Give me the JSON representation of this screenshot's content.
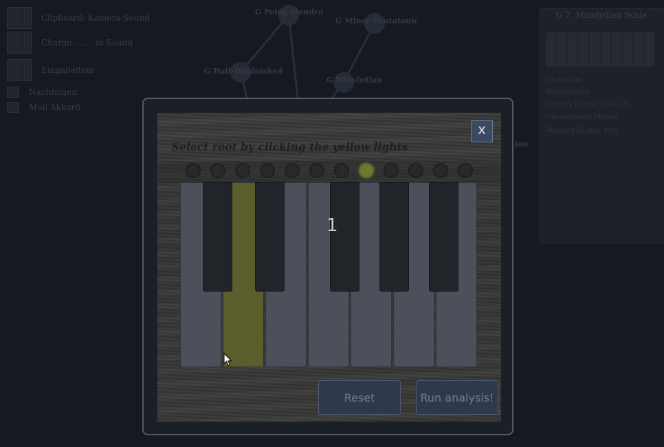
{
  "background": {
    "list_items": [
      {
        "label": "Clipboard: Kamera Sound"
      },
      {
        "label": "Charge: ...... in Sound"
      },
      {
        "label": "Eingabeitem"
      },
      {
        "label": "Nachfolgen"
      },
      {
        "label": "Moll Akkord"
      }
    ],
    "graph_nodes": [
      {
        "label": "G Pelog Slendro"
      },
      {
        "label": "G Minor Pentatonic"
      },
      {
        "label": "G Half-Diminished"
      },
      {
        "label": "G Mixolydian"
      }
    ],
    "edge_label": "ion",
    "side_panel": {
      "title": "G 7. Mixolydian Scale",
      "lines": [
        "Character",
        "Progression",
        "Chords in the scale, G...",
        "Harmonized Modes",
        "Related Scales Info"
      ]
    }
  },
  "modal": {
    "close_label": "X",
    "instruction": "Select root by clicking the yellow lights",
    "lights": [
      {
        "state": "off"
      },
      {
        "state": "off"
      },
      {
        "state": "off"
      },
      {
        "state": "off"
      },
      {
        "state": "off"
      },
      {
        "state": "off"
      },
      {
        "state": "off"
      },
      {
        "state": "on"
      },
      {
        "state": "off"
      },
      {
        "state": "off"
      },
      {
        "state": "off"
      },
      {
        "state": "off"
      }
    ],
    "keyboard": {
      "selected_white_key": 1,
      "marker_label": "1"
    },
    "reset_label": "Reset",
    "run_label": "Run analysis!"
  },
  "colors": {
    "light_on": "#6f7830",
    "light_off": "#272a26",
    "selected_key": "#5c612d",
    "button_bg": "#2e3a4b"
  }
}
